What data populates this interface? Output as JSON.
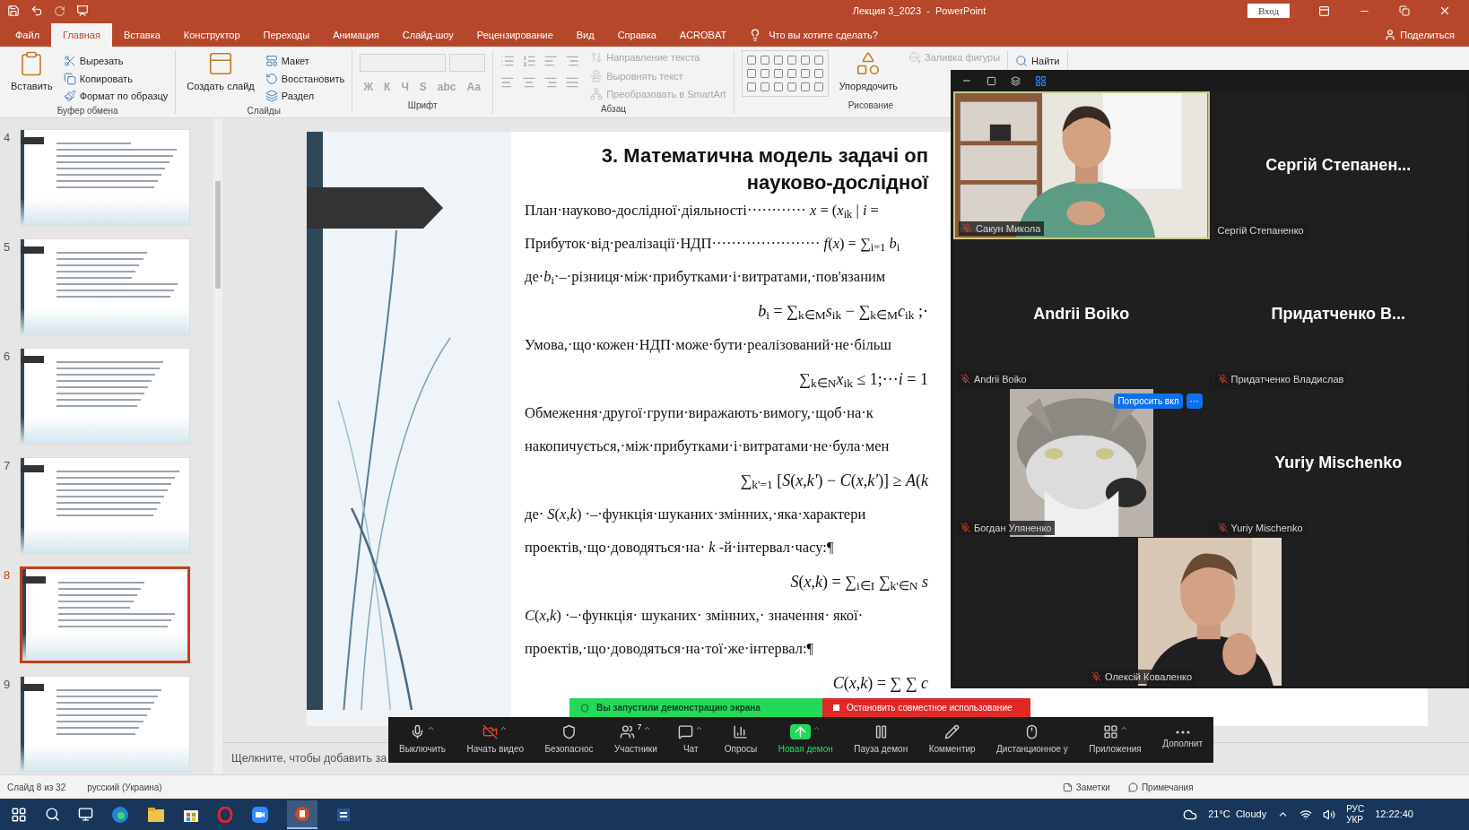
{
  "title_bar": {
    "title": "Лекция 3_2023  -  PowerPoint",
    "sign_in": "Вход"
  },
  "tabs": [
    {
      "label": "Файл",
      "selected": false
    },
    {
      "label": "Главная",
      "selected": true
    },
    {
      "label": "Вставка",
      "selected": false
    },
    {
      "label": "Конструктор",
      "selected": false
    },
    {
      "label": "Переходы",
      "selected": false
    },
    {
      "label": "Анимация",
      "selected": false
    },
    {
      "label": "Слайд-шоу",
      "selected": false
    },
    {
      "label": "Рецензирование",
      "selected": false
    },
    {
      "label": "Вид",
      "selected": false
    },
    {
      "label": "Справка",
      "selected": false
    },
    {
      "label": "ACROBAT",
      "selected": false
    }
  ],
  "tell_me": "Что вы хотите сделать?",
  "share": "Поделиться",
  "ribbon": [
    {
      "kind": "stack",
      "label": "Буфер обмена",
      "items": [
        {
          "kind": "large",
          "label": "Вставить",
          "disabled": false
        },
        {
          "kind": "small",
          "label": "Вырезать",
          "disabled": false
        },
        {
          "kind": "small",
          "label": "Копировать",
          "disabled": false
        },
        {
          "kind": "small",
          "label": "Формат по образцу",
          "disabled": false
        }
      ]
    },
    {
      "kind": "stack",
      "label": "Слайды",
      "items": [
        {
          "kind": "large",
          "label": "Создать слайд",
          "disabled": false
        },
        {
          "kind": "small",
          "label": "Макет",
          "disabled": false
        },
        {
          "kind": "small",
          "label": "Восстановить",
          "disabled": false
        },
        {
          "kind": "small",
          "label": "Раздел",
          "disabled": false
        }
      ]
    },
    {
      "kind": "rows",
      "label": "Шрифт",
      "items": [
        {
          "kind": "toggle",
          "label": "Ж",
          "disabled": true
        },
        {
          "kind": "toggle",
          "label": "К",
          "disabled": true
        },
        {
          "kind": "toggle",
          "label": "Ч",
          "disabled": true
        },
        {
          "kind": "toggle",
          "label": "S",
          "disabled": true
        },
        {
          "kind": "toggle",
          "label": "abc",
          "disabled": true
        },
        {
          "kind": "toggle",
          "label": "Аа",
          "disabled": true
        }
      ]
    },
    {
      "kind": "paragraph",
      "label": "Абзац",
      "items": [
        {
          "kind": "small",
          "label": "Направление текста",
          "disabled": true
        },
        {
          "kind": "small",
          "label": "Выровнять текст",
          "disabled": true
        },
        {
          "kind": "small",
          "label": "Преобразовать в SmartArt",
          "disabled": true
        }
      ]
    },
    {
      "kind": "drawing",
      "label": "Рисование",
      "items": [
        {
          "kind": "large",
          "label": "Упорядочить",
          "disabled": false
        },
        {
          "kind": "small",
          "label": "Заливка фигуры",
          "disabled": true
        }
      ]
    },
    {
      "kind": "stack",
      "items": [
        {
          "kind": "small",
          "label": "Найти",
          "disabled": false
        }
      ]
    }
  ],
  "thumbnails": [
    {
      "number": "4",
      "selected": false
    },
    {
      "number": "5",
      "selected": false
    },
    {
      "number": "6",
      "selected": false
    },
    {
      "number": "7",
      "selected": false
    },
    {
      "number": "8",
      "selected": true
    },
    {
      "number": "9",
      "selected": false
    }
  ],
  "slide": {
    "title": [
      "3. Математична модель задачі оп",
      "науково-дослідної"
    ],
    "lines": [
      {
        "kind": "text",
        "text": "План·науково-дослідної·діяльності············ *x* = (*x*$_{ik}$ | *i* ="
      },
      {
        "kind": "text",
        "text": "Прибуток·від·реалізації·НДП······················ *f*(*x*) = ∑$_{i=1}$ *b*$_{i}$"
      },
      {
        "kind": "text",
        "text": "де·*b*$_{i}$·–·різниця·між·прибутками·і·витратами,·пов'язаним"
      },
      {
        "kind": "formula",
        "text": "*b*$_{i}$ = ∑$_{k∈M}$*s*$_{ik}$ − ∑$_{k∈M}$*c*$_{ik}$ ;·"
      },
      {
        "kind": "text",
        "text": "Умова,·що·кожен·НДП·може·бути·реалізований·не·більш"
      },
      {
        "kind": "formula",
        "text": "∑$_{k∈N}$*x*$_{ik}$ ≤ 1;···*i* = 1"
      },
      {
        "kind": "text",
        "text": "Обмеження·другої·групи·виражають·вимогу,·щоб·на·к"
      },
      {
        "kind": "text",
        "text": "накопичується,·між·прибутками·і·витратами·не·була·мен"
      },
      {
        "kind": "formula",
        "text": "∑$_{k'=1}$ [*S*(*x*,*k'*) − *C*(*x*,*k'*)] ≥ *A*(*k*"
      },
      {
        "kind": "text",
        "text": "де· *S*(*x*,*k*) ·–·функція·шуканих·змінних,·яка·характери"
      },
      {
        "kind": "text",
        "text": "проектів,·що·доводяться·на· *k* -й·інтервал·часу:¶"
      },
      {
        "kind": "formula",
        "text": "*S*(*x*,*k*) = ∑$_{i∈I}$ ∑$_{k'∈N}$ *s*"
      },
      {
        "kind": "text",
        "text": "*C*(*x*,*k*) ·–·функція· шуканих· змінних,· значення· якої·"
      },
      {
        "kind": "text",
        "text": "проектів,·що·доводяться·на·тої·же·інтервал:¶"
      },
      {
        "kind": "formula",
        "text": "*C*(*x*,*k*) = ∑ ∑ *c*"
      }
    ]
  },
  "notes_placeholder": "Щелкните, чтобы добавить за",
  "status_bar": {
    "slide": "Слайд 8 из 32",
    "language": "русский (Украина)",
    "notes": "Заметки",
    "comments": "Примечания"
  },
  "zoom": {
    "tiles": [
      {
        "kind": "video",
        "label": "Сакун Микола",
        "muted": true,
        "speaking": true
      },
      {
        "kind": "name",
        "display_name": "Сергій  Степанен...",
        "label": "Сергій Степаненко",
        "muted": false,
        "speaking": false
      },
      {
        "kind": "name",
        "display_name": "Andrii Boiko",
        "label": "Andrii Boiko",
        "muted": true,
        "speaking": false
      },
      {
        "kind": "name",
        "display_name": "Придатченко  В...",
        "label": "Придатченко Владислав",
        "muted": true,
        "speaking": false
      },
      {
        "kind": "video",
        "label": "Богдан Уляненко",
        "muted": true,
        "speaking": false,
        "actions": [
          "Попросить вкл",
          "···"
        ]
      },
      {
        "kind": "name",
        "display_name": "Yuriy Mischenko",
        "label": "Yuriy Mischenko",
        "muted": true,
        "speaking": false
      },
      {
        "kind": "video",
        "label": "Олексій Коваленко",
        "muted": true,
        "speaking": false
      }
    ],
    "share_banner": "Вы запустили демонстрацию экрана",
    "stop_share": "Остановить совместное использование",
    "toolbar": [
      {
        "label": "Выключить",
        "caret": true,
        "active": false
      },
      {
        "label": "Начать видео",
        "caret": true,
        "active": false
      },
      {
        "label": "Безопаснос",
        "caret": false,
        "active": false
      },
      {
        "label": "Участники",
        "caret": true,
        "active": false,
        "badge": "7"
      },
      {
        "label": "Чат",
        "caret": true,
        "active": false
      },
      {
        "label": "Опросы",
        "caret": false,
        "active": false
      },
      {
        "label": "Новая демон",
        "caret": true,
        "active": true
      },
      {
        "label": "Пауза демон",
        "caret": false,
        "active": false
      },
      {
        "label": "Комментир",
        "caret": false,
        "active": false
      },
      {
        "label": "Дистанционное у",
        "caret": false,
        "active": false
      },
      {
        "label": "Приложения",
        "caret": true,
        "active": false
      },
      {
        "label": "Дополнит",
        "caret": false,
        "active": false
      }
    ]
  },
  "taskbar": {
    "weather": "21°C  Cloudy",
    "input_language": [
      "РУС",
      "УКР"
    ],
    "time": "12:22:40"
  }
}
